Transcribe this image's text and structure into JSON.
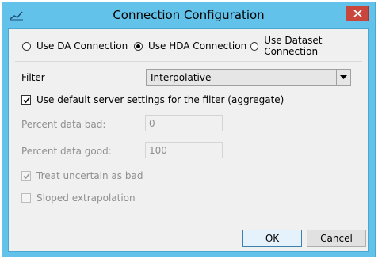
{
  "window": {
    "title": "Connection Configuration",
    "icon": "app-icon",
    "close_icon": "close-icon"
  },
  "connection": {
    "options": [
      {
        "label": "Use DA Connection",
        "checked": false
      },
      {
        "label": "Use HDA Connection",
        "checked": true
      },
      {
        "label": "Use Dataset Connection",
        "checked": false
      }
    ]
  },
  "filter": {
    "label": "Filter",
    "value": "Interpolative"
  },
  "default_settings": {
    "label": "Use default server settings for the filter (aggregate)",
    "checked": true
  },
  "percent_bad": {
    "label": "Percent data bad:",
    "value": "0"
  },
  "percent_good": {
    "label": "Percent data good:",
    "value": "100"
  },
  "treat_uncertain": {
    "label": "Treat uncertain as bad",
    "checked": true,
    "enabled": false
  },
  "sloped": {
    "label": "Sloped extrapolation",
    "checked": false,
    "enabled": false
  },
  "buttons": {
    "ok": "OK",
    "cancel": "Cancel"
  },
  "colors": {
    "titlebar": "#62c2e9",
    "close": "#c9463d",
    "client": "#f0f0f0"
  }
}
